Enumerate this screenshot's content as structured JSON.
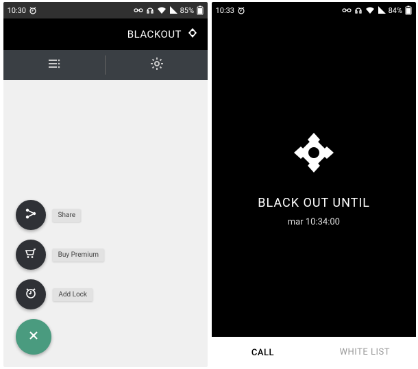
{
  "screenA": {
    "status": {
      "battery": "84%",
      "time": "10:33"
    },
    "headline": "BLACK OUT UNTIL",
    "subtext": "mar 10:34:00",
    "tabs": {
      "left": "WHITE LIST",
      "right": "CALL"
    }
  },
  "screenB": {
    "status": {
      "battery": "85%",
      "time": "10:30"
    },
    "appTitle": "BLACKOUT",
    "fab": {
      "share": "Share",
      "buy": "Buy Premium",
      "add": "Add Lock"
    }
  }
}
